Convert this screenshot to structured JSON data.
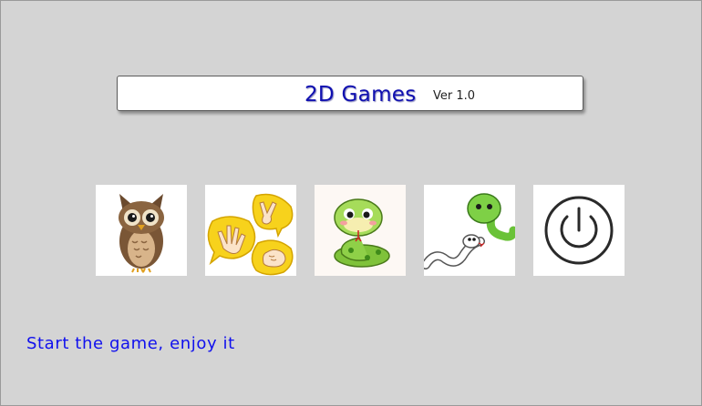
{
  "header": {
    "title": "2D Games",
    "version": "Ver 1.0"
  },
  "games": [
    {
      "icon": "owl-icon",
      "label": "Owl"
    },
    {
      "icon": "rock-paper-scissors-icon",
      "label": "Rock Paper Scissors"
    },
    {
      "icon": "snake-icon",
      "label": "Snake"
    },
    {
      "icon": "snakes-icon",
      "label": "Snakes"
    },
    {
      "icon": "power-icon",
      "label": "Quit"
    }
  ],
  "status_text": "Start the game, enjoy it",
  "colors": {
    "background": "#d4d4d4",
    "title": "#1010b0",
    "status": "#1010ee"
  }
}
